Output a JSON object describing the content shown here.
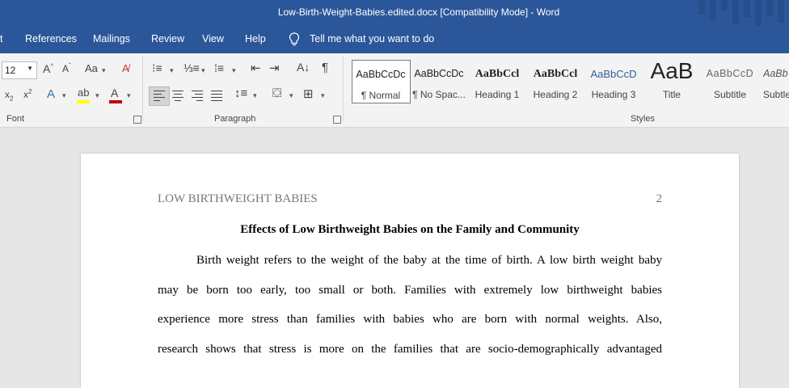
{
  "window": {
    "title": "Low-Birth-Weight-Babies.edited.docx [Compatibility Mode]  -  Word"
  },
  "menu": {
    "items": [
      "t",
      "References",
      "Mailings",
      "Review",
      "View",
      "Help"
    ],
    "tell_me": "Tell me what you want to do"
  },
  "ribbon": {
    "font_size": "12",
    "groups": {
      "font": "Font",
      "paragraph": "Paragraph",
      "styles": "Styles"
    },
    "styles": [
      {
        "preview": "AaBbCcDc",
        "label": "¶ Normal"
      },
      {
        "preview": "AaBbCcDc",
        "label": "¶ No Spac..."
      },
      {
        "preview": "AaBbCcl",
        "label": "Heading 1"
      },
      {
        "preview": "AaBbCcl",
        "label": "Heading 2"
      },
      {
        "preview": "AaBbCcD",
        "label": "Heading 3"
      },
      {
        "preview": "AaB",
        "label": "Title"
      },
      {
        "preview": "AaBbCcD",
        "label": "Subtitle"
      },
      {
        "preview": "AaBb",
        "label": "Subtle"
      }
    ],
    "colors": {
      "highlight": "#ffff00",
      "font_color": "#c00000",
      "accent": "#2b579a"
    }
  },
  "document": {
    "running_head": "LOW BIRTHWEIGHT BABIES",
    "page_number": "2",
    "heading": "Effects of Low Birthweight Babies on the Family and Community",
    "lines": [
      "Birth weight refers to the weight of the baby at the time of birth. A low birth weight baby",
      "may be born too early, too small or both. Families with extremely low birthweight babies",
      "experience more stress than families with babies who are born with normal weights. Also,",
      "research shows that stress is more on the families that are socio-demographically advantaged"
    ]
  }
}
